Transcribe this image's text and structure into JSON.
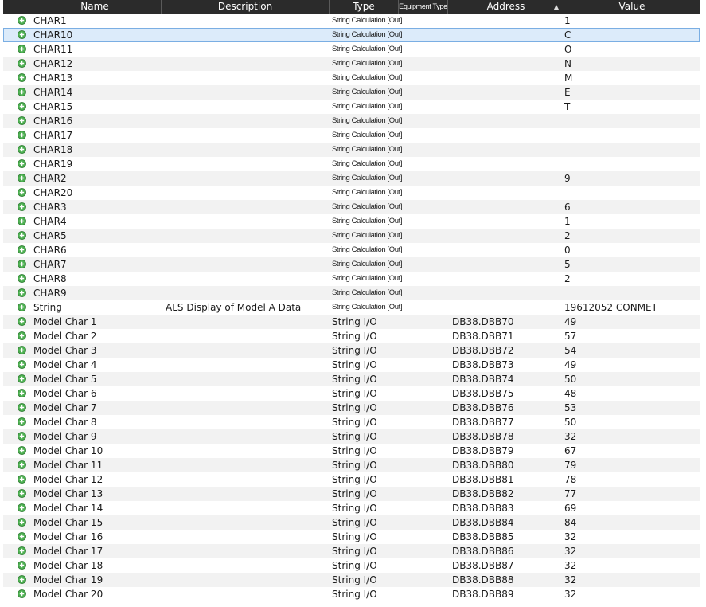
{
  "columns": {
    "name": "Name",
    "description": "Description",
    "type": "Type",
    "equipment_type": "Equipment Type",
    "address": "Address",
    "value": "Value"
  },
  "sort": {
    "column": "address",
    "direction": "ascending"
  },
  "colors": {
    "header_bg": "#2b2b2b",
    "row_alt": "#f2f2f2",
    "selected_row": "#dcebfa",
    "selected_border": "#7aaee3",
    "icon_green": "#4caf50"
  },
  "rows": [
    {
      "name": "CHAR1",
      "description": "",
      "type": "String Calculation [Out]",
      "address": "",
      "value": "1"
    },
    {
      "name": "CHAR10",
      "description": "",
      "type": "String Calculation [Out]",
      "address": "",
      "value": "C"
    },
    {
      "name": "CHAR11",
      "description": "",
      "type": "String Calculation [Out]",
      "address": "",
      "value": "O"
    },
    {
      "name": "CHAR12",
      "description": "",
      "type": "String Calculation [Out]",
      "address": "",
      "value": "N"
    },
    {
      "name": "CHAR13",
      "description": "",
      "type": "String Calculation [Out]",
      "address": "",
      "value": "M"
    },
    {
      "name": "CHAR14",
      "description": "",
      "type": "String Calculation [Out]",
      "address": "",
      "value": "E"
    },
    {
      "name": "CHAR15",
      "description": "",
      "type": "String Calculation [Out]",
      "address": "",
      "value": "T"
    },
    {
      "name": "CHAR16",
      "description": "",
      "type": "String Calculation [Out]",
      "address": "",
      "value": ""
    },
    {
      "name": "CHAR17",
      "description": "",
      "type": "String Calculation [Out]",
      "address": "",
      "value": ""
    },
    {
      "name": "CHAR18",
      "description": "",
      "type": "String Calculation [Out]",
      "address": "",
      "value": ""
    },
    {
      "name": "CHAR19",
      "description": "",
      "type": "String Calculation [Out]",
      "address": "",
      "value": ""
    },
    {
      "name": "CHAR2",
      "description": "",
      "type": "String Calculation [Out]",
      "address": "",
      "value": "9"
    },
    {
      "name": "CHAR20",
      "description": "",
      "type": "String Calculation [Out]",
      "address": "",
      "value": ""
    },
    {
      "name": "CHAR3",
      "description": "",
      "type": "String Calculation [Out]",
      "address": "",
      "value": "6"
    },
    {
      "name": "CHAR4",
      "description": "",
      "type": "String Calculation [Out]",
      "address": "",
      "value": "1"
    },
    {
      "name": "CHAR5",
      "description": "",
      "type": "String Calculation [Out]",
      "address": "",
      "value": "2"
    },
    {
      "name": "CHAR6",
      "description": "",
      "type": "String Calculation [Out]",
      "address": "",
      "value": "0"
    },
    {
      "name": "CHAR7",
      "description": "",
      "type": "String Calculation [Out]",
      "address": "",
      "value": "5"
    },
    {
      "name": "CHAR8",
      "description": "",
      "type": "String Calculation [Out]",
      "address": "",
      "value": "2"
    },
    {
      "name": "CHAR9",
      "description": "",
      "type": "String Calculation [Out]",
      "address": "",
      "value": ""
    },
    {
      "name": "String",
      "description": "ALS Display of Model A Data",
      "type": "String Calculation [Out]",
      "address": "",
      "value": "19612052 CONMET"
    },
    {
      "name": "Model Char 1",
      "description": "",
      "type": "String I/O",
      "address": "DB38.DBB70",
      "value": "49"
    },
    {
      "name": "Model Char 2",
      "description": "",
      "type": "String I/O",
      "address": "DB38.DBB71",
      "value": "57"
    },
    {
      "name": "Model Char 3",
      "description": "",
      "type": "String I/O",
      "address": "DB38.DBB72",
      "value": "54"
    },
    {
      "name": "Model Char 4",
      "description": "",
      "type": "String I/O",
      "address": "DB38.DBB73",
      "value": "49"
    },
    {
      "name": "Model Char 5",
      "description": "",
      "type": "String I/O",
      "address": "DB38.DBB74",
      "value": "50"
    },
    {
      "name": "Model Char 6",
      "description": "",
      "type": "String I/O",
      "address": "DB38.DBB75",
      "value": "48"
    },
    {
      "name": "Model Char 7",
      "description": "",
      "type": "String I/O",
      "address": "DB38.DBB76",
      "value": "53"
    },
    {
      "name": "Model Char 8",
      "description": "",
      "type": "String I/O",
      "address": "DB38.DBB77",
      "value": "50"
    },
    {
      "name": "Model Char 9",
      "description": "",
      "type": "String I/O",
      "address": "DB38.DBB78",
      "value": "32"
    },
    {
      "name": "Model Char 10",
      "description": "",
      "type": "String I/O",
      "address": "DB38.DBB79",
      "value": "67"
    },
    {
      "name": "Model Char 11",
      "description": "",
      "type": "String I/O",
      "address": "DB38.DBB80",
      "value": "79"
    },
    {
      "name": "Model Char 12",
      "description": "",
      "type": "String I/O",
      "address": "DB38.DBB81",
      "value": "78"
    },
    {
      "name": "Model Char 13",
      "description": "",
      "type": "String I/O",
      "address": "DB38.DBB82",
      "value": "77"
    },
    {
      "name": "Model Char 14",
      "description": "",
      "type": "String I/O",
      "address": "DB38.DBB83",
      "value": "69"
    },
    {
      "name": "Model Char 15",
      "description": "",
      "type": "String I/O",
      "address": "DB38.DBB84",
      "value": "84"
    },
    {
      "name": "Model Char 16",
      "description": "",
      "type": "String I/O",
      "address": "DB38.DBB85",
      "value": "32"
    },
    {
      "name": "Model Char 17",
      "description": "",
      "type": "String I/O",
      "address": "DB38.DBB86",
      "value": "32"
    },
    {
      "name": "Model Char 18",
      "description": "",
      "type": "String I/O",
      "address": "DB38.DBB87",
      "value": "32"
    },
    {
      "name": "Model Char 19",
      "description": "",
      "type": "String I/O",
      "address": "DB38.DBB88",
      "value": "32"
    },
    {
      "name": "Model Char 20",
      "description": "",
      "type": "String I/O",
      "address": "DB38.DBB89",
      "value": "32"
    }
  ],
  "selected_row": 1,
  "row_icon": "add-circle-icon"
}
